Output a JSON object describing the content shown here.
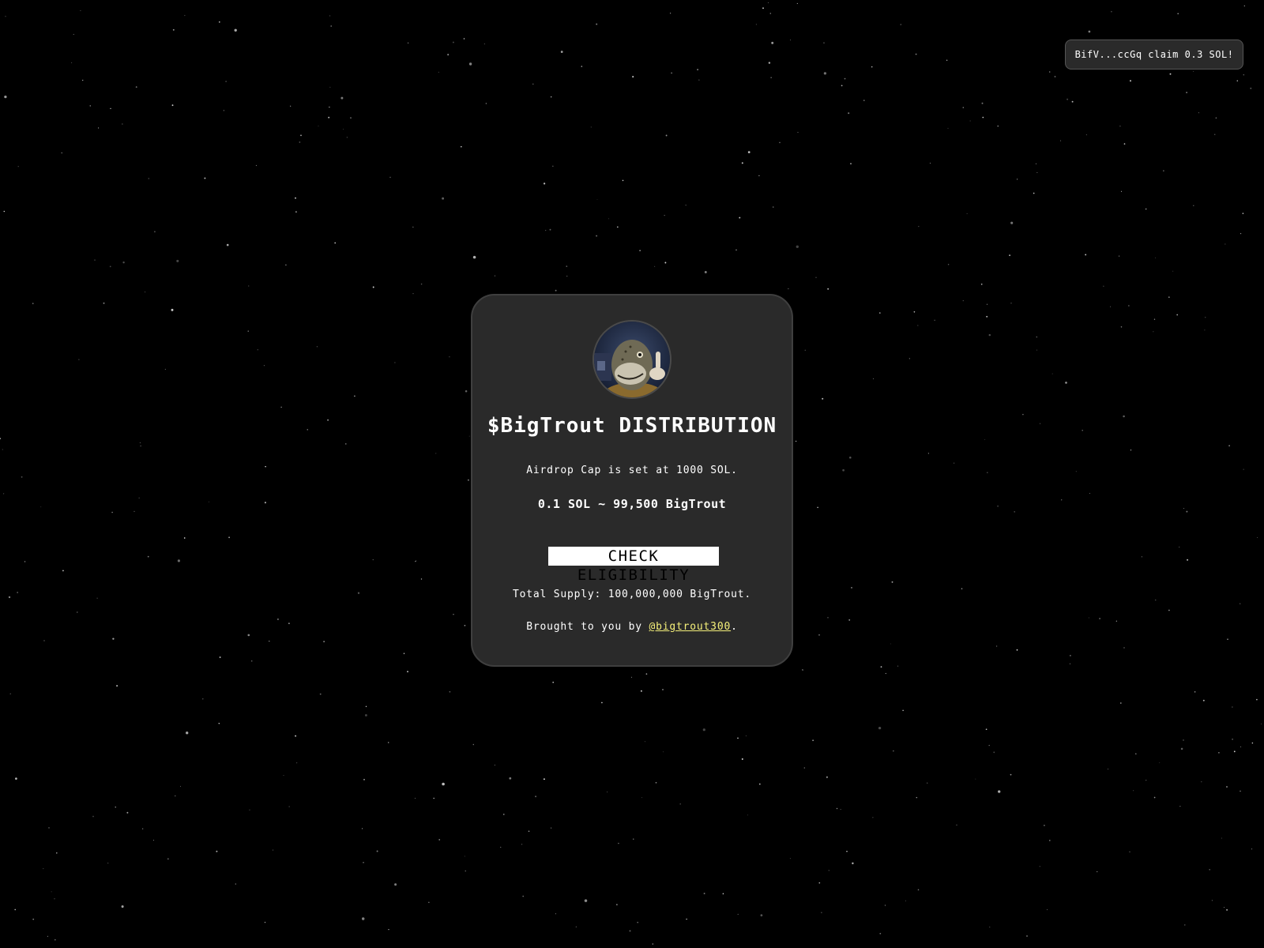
{
  "background": {
    "color": "#000000"
  },
  "toast": {
    "text": "BifV...ccGq claim 0.3 SOL!"
  },
  "card": {
    "avatar_alt": "BigTrout avatar",
    "title": "$BigTrout DISTRIBUTION",
    "cap_text": "Airdrop Cap is set at 1000 SOL.",
    "rate_text": "0.1 SOL ~ 99,500 BigTrout",
    "check_button_label": "CHECK ELIGIBILITY",
    "supply_text": "Total Supply: 100,000,000 BigTrout.",
    "credit_prefix": "Brought to you by ",
    "credit_link": "@bigtrout300",
    "credit_suffix": "."
  },
  "colors": {
    "card_bg": "#2a2a2a",
    "link": "#f5f07a",
    "button_bg": "#ffffff",
    "text": "#ffffff"
  }
}
